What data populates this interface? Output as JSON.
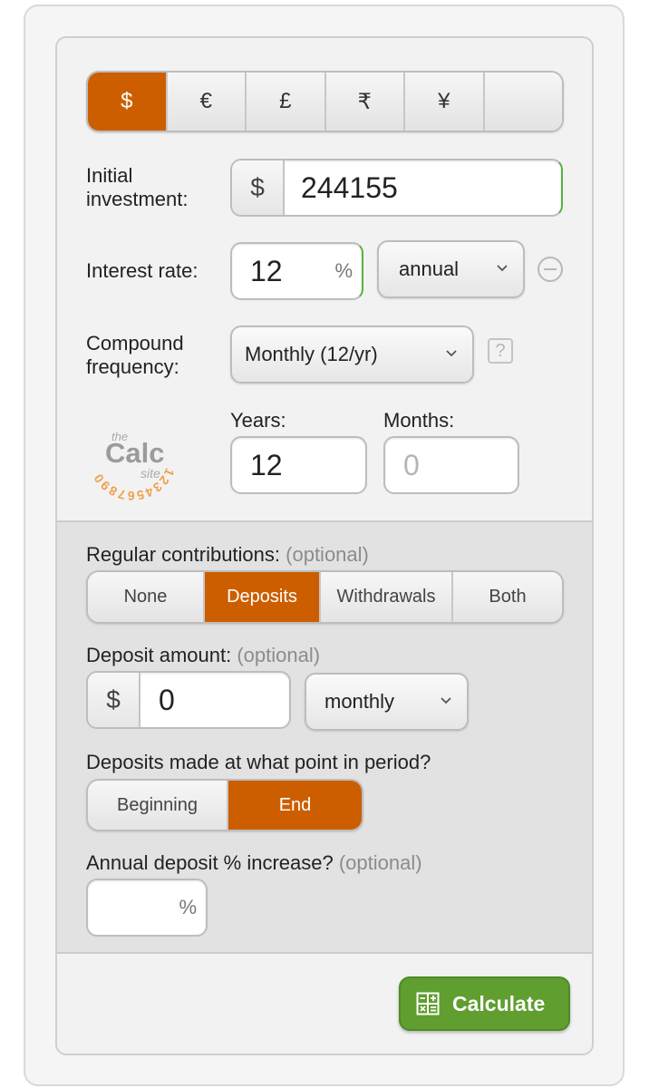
{
  "currency": {
    "options": [
      "$",
      "€",
      "£",
      "₹",
      "¥",
      ""
    ],
    "selected": "$"
  },
  "initial_investment": {
    "label_line1": "Initial",
    "label_line2": "investment:",
    "prefix": "$",
    "value": "244155"
  },
  "interest_rate": {
    "label": "Interest rate:",
    "value": "12",
    "suffix": "%",
    "period": "annual"
  },
  "compound_frequency": {
    "label_line1": "Compound",
    "label_line2": "frequency:",
    "value": "Monthly (12/yr)",
    "help": "?"
  },
  "logo": {
    "digits": "1234567890",
    "word_the": "the",
    "word_calc": "Calc",
    "word_site": "site"
  },
  "duration": {
    "years_label": "Years:",
    "years_value": "12",
    "months_label": "Months:",
    "months_placeholder": "0"
  },
  "regular_contributions": {
    "label": "Regular contributions:",
    "optional": "(optional)",
    "options": [
      "None",
      "Deposits",
      "Withdrawals",
      "Both"
    ],
    "selected": "Deposits"
  },
  "deposit_amount": {
    "label": "Deposit amount:",
    "optional": "(optional)",
    "prefix": "$",
    "value": "0",
    "frequency": "monthly"
  },
  "deposit_timing": {
    "label": "Deposits made at what point in period?",
    "options": [
      "Beginning",
      "End"
    ],
    "selected": "End"
  },
  "annual_increase": {
    "label": "Annual deposit % increase?",
    "optional": "(optional)",
    "suffix": "%"
  },
  "calculate_button": {
    "label": "Calculate"
  },
  "colors": {
    "accent_orange": "#cc5e00",
    "button_green": "#5f9e2f",
    "focus_green": "#57b33e",
    "logo_orange": "#f0a04b"
  }
}
